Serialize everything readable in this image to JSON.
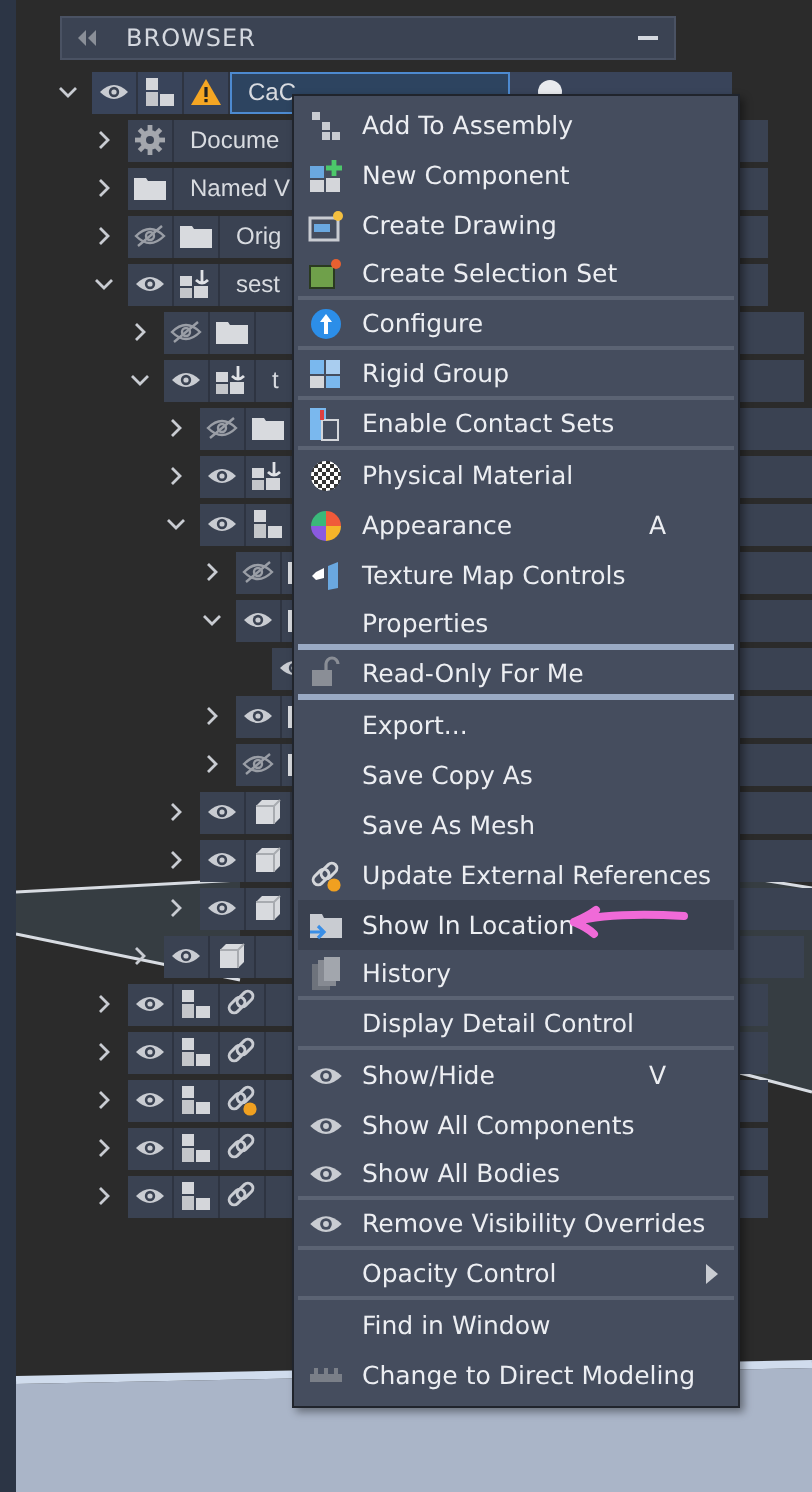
{
  "browser": {
    "title": "BROWSER",
    "tree": [
      {
        "kind": "component",
        "label": "CaC",
        "expanded": true,
        "visible": true,
        "selected": true,
        "warning": true,
        "children": [
          {
            "kind": "settings",
            "label": "Docume",
            "expanded": false,
            "selected": false
          },
          {
            "kind": "folder",
            "label": "Named V",
            "expanded": false,
            "selected": false
          },
          {
            "kind": "folder",
            "label": "Orig",
            "expanded": false,
            "visible": false,
            "selected": false
          },
          {
            "kind": "anchored",
            "label": "sest",
            "expanded": true,
            "visible": true,
            "selected": false,
            "children": [
              {
                "kind": "folder",
                "expanded": false,
                "visible": false,
                "selected": false
              },
              {
                "kind": "anchored",
                "label": "t",
                "expanded": true,
                "visible": true,
                "selected": false,
                "children": [
                  {
                    "kind": "folder",
                    "expanded": false,
                    "visible": false,
                    "selected": false
                  },
                  {
                    "kind": "anchored",
                    "expanded": false,
                    "visible": true,
                    "selected": false
                  },
                  {
                    "kind": "component",
                    "expanded": true,
                    "visible": true,
                    "selected": false,
                    "children": [
                      {
                        "kind": "folder",
                        "expanded": false,
                        "visible": false,
                        "selected": false
                      },
                      {
                        "kind": "folder",
                        "expanded": true,
                        "visible": true,
                        "selected": false,
                        "children": [
                          {
                            "visible": true
                          }
                        ]
                      },
                      {
                        "kind": "folder",
                        "expanded": false,
                        "visible": true,
                        "selected": false
                      },
                      {
                        "kind": "folder",
                        "expanded": false,
                        "visible": false,
                        "selected": false
                      }
                    ]
                  },
                  {
                    "kind": "body",
                    "expanded": false,
                    "visible": true,
                    "selected": false
                  },
                  {
                    "kind": "body",
                    "expanded": false,
                    "visible": true,
                    "selected": false
                  },
                  {
                    "kind": "body",
                    "expanded": false,
                    "visible": true,
                    "selected": false
                  }
                ]
              },
              {
                "kind": "body",
                "expanded": false,
                "visible": true,
                "selected": false
              }
            ]
          },
          {
            "kind": "linked",
            "expanded": false,
            "visible": true,
            "selected": false,
            "out_of_date": false
          },
          {
            "kind": "linked",
            "expanded": false,
            "visible": true,
            "selected": false,
            "out_of_date": false
          },
          {
            "kind": "linked",
            "expanded": false,
            "visible": true,
            "selected": false,
            "out_of_date": true
          },
          {
            "kind": "linked",
            "expanded": false,
            "visible": true,
            "selected": false,
            "out_of_date": false
          },
          {
            "kind": "linked",
            "expanded": false,
            "visible": true,
            "selected": false,
            "out_of_date": false
          }
        ]
      }
    ]
  },
  "context_menu": {
    "items": [
      {
        "label": "Add To Assembly",
        "selected": false,
        "divider_after": false,
        "bold_divider": false
      },
      {
        "label": "New Component",
        "selected": false,
        "divider_after": false,
        "bold_divider": false
      },
      {
        "label": "Create Drawing",
        "selected": false,
        "divider_after": false,
        "bold_divider": false
      },
      {
        "label": "Create Selection Set",
        "selected": false,
        "divider_after": true,
        "bold_divider": false
      },
      {
        "label": "Configure",
        "selected": false,
        "divider_after": true,
        "bold_divider": false
      },
      {
        "label": "Rigid Group",
        "selected": false,
        "divider_after": true,
        "bold_divider": false
      },
      {
        "label": "Enable Contact Sets",
        "selected": false,
        "divider_after": true,
        "bold_divider": false
      },
      {
        "label": "Physical Material",
        "selected": false,
        "divider_after": false,
        "bold_divider": false
      },
      {
        "label": "Appearance",
        "shortcut": "A",
        "selected": false,
        "divider_after": false,
        "bold_divider": false
      },
      {
        "label": "Texture Map Controls",
        "selected": false,
        "divider_after": false,
        "bold_divider": false
      },
      {
        "label": "Properties",
        "selected": false,
        "divider_after": true,
        "bold_divider": true
      },
      {
        "label": "Read-Only For Me",
        "selected": false,
        "divider_after": true,
        "bold_divider": true
      },
      {
        "label": "Export...",
        "selected": false,
        "divider_after": false,
        "bold_divider": false
      },
      {
        "label": "Save Copy As",
        "selected": false,
        "divider_after": false,
        "bold_divider": false
      },
      {
        "label": "Save As Mesh",
        "selected": false,
        "divider_after": false,
        "bold_divider": false
      },
      {
        "label": "Update External References",
        "selected": false,
        "divider_after": false,
        "bold_divider": false
      },
      {
        "label": "Show In Location",
        "selected": true,
        "divider_after": false,
        "bold_divider": false
      },
      {
        "label": "History",
        "selected": false,
        "divider_after": true,
        "bold_divider": false
      },
      {
        "label": "Display Detail Control",
        "selected": false,
        "divider_after": true,
        "bold_divider": false
      },
      {
        "label": "Show/Hide",
        "shortcut": "V",
        "selected": false,
        "divider_after": false,
        "bold_divider": false
      },
      {
        "label": "Show All Components",
        "selected": false,
        "divider_after": false,
        "bold_divider": false
      },
      {
        "label": "Show All Bodies",
        "selected": false,
        "divider_after": true,
        "bold_divider": false
      },
      {
        "label": "Remove Visibility Overrides",
        "selected": false,
        "divider_after": true,
        "bold_divider": false
      },
      {
        "label": "Opacity Control",
        "submenu": true,
        "selected": false,
        "divider_after": true,
        "bold_divider": false
      },
      {
        "label": "Find in Window",
        "selected": false,
        "divider_after": false,
        "bold_divider": false
      },
      {
        "label": "Change to Direct Modeling",
        "selected": false,
        "divider_after": false,
        "bold_divider": false
      }
    ]
  }
}
